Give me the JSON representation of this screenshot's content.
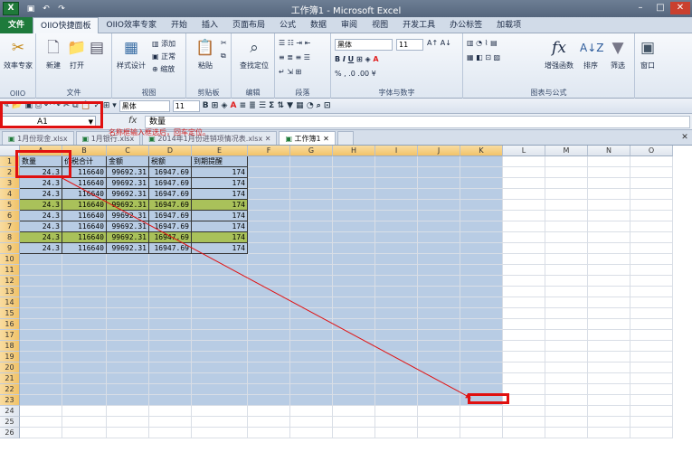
{
  "app": {
    "title": "工作簿1 - Microsoft Excel",
    "logo": "X"
  },
  "ribbon_tabs": [
    "文件",
    "OIIO快捷面板",
    "OIIO效率专家",
    "开始",
    "插入",
    "页面布局",
    "公式",
    "数据",
    "审阅",
    "视图",
    "开发工具",
    "办公标签",
    "加载项"
  ],
  "ribbon": {
    "groups": {
      "oiio": "OIIO",
      "file": "文件",
      "view": "视图",
      "clipboard": "剪贴板",
      "edit": "编辑",
      "paragraph": "段落",
      "font_num": "字体与数字",
      "chart_formula": "图表与公式"
    },
    "buttons": {
      "efficiency": "效率专家",
      "new": "新建",
      "open": "打开",
      "style": "样式设计",
      "add": "添加",
      "normal": "正常",
      "zoom": "缩放",
      "paste": "粘贴",
      "find": "查找定位",
      "enhanced": "增强函数",
      "sort": "排序",
      "filter": "筛选",
      "window": "窗口"
    },
    "font_name": "黑体",
    "font_size": "11"
  },
  "toolbar2": {
    "font_name": "黑体",
    "font_size": "11"
  },
  "formula_bar": {
    "name_box": "A1",
    "fx": "fx",
    "content": "数量"
  },
  "workbook_tabs": [
    "1月份现金.xlsx",
    "1月银行.xlsx",
    "2014年1月份进销项情况表.xlsx",
    "工作簿1"
  ],
  "annotation": {
    "text": "名称框输入框选后，回车定位。",
    "color": "#d02020"
  },
  "columns": [
    "A",
    "B",
    "C",
    "D",
    "E",
    "F",
    "G",
    "H",
    "I",
    "J",
    "K",
    "L",
    "M",
    "N",
    "O"
  ],
  "rows": [
    "1",
    "2",
    "3",
    "4",
    "5",
    "6",
    "7",
    "8",
    "9",
    "10",
    "11",
    "12",
    "13",
    "14",
    "15",
    "16",
    "17",
    "18",
    "19",
    "20",
    "21",
    "22",
    "23",
    "24",
    "25",
    "26"
  ],
  "table": {
    "headers": [
      "数量",
      "价税合计",
      "金额",
      "税额",
      "到期提醒"
    ],
    "data": [
      [
        "24.3",
        "116640",
        "99692.31",
        "16947.69",
        "174"
      ],
      [
        "24.3",
        "116640",
        "99692.31",
        "16947.69",
        "174"
      ],
      [
        "24.3",
        "116640",
        "99692.31",
        "16947.69",
        "174"
      ],
      [
        "24.3",
        "116640",
        "99692.31",
        "16947.69",
        "174"
      ],
      [
        "24.3",
        "116640",
        "99692.31",
        "16947.69",
        "174"
      ],
      [
        "24.3",
        "116640",
        "99692.31",
        "16947.69",
        "174"
      ],
      [
        "24.3",
        "116640",
        "99692.31",
        "16947.69",
        "174"
      ],
      [
        "24.3",
        "116640",
        "99692.31",
        "16947.69",
        "174"
      ]
    ]
  },
  "colors": {
    "selection": "#b8cce4",
    "band": "#a9c15a",
    "highlight": "#e01010"
  }
}
